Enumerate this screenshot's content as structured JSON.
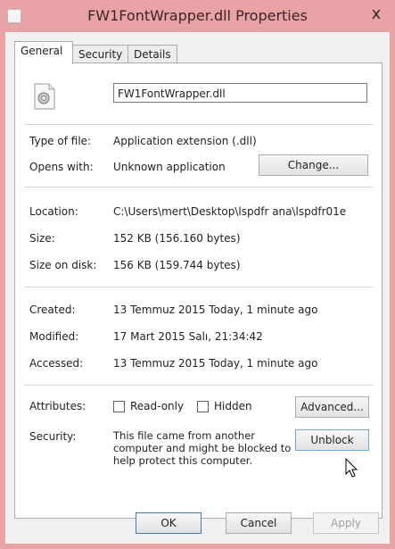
{
  "window": {
    "title": "FW1FontWrapper.dll Properties",
    "close_glyph": "x"
  },
  "tabs": [
    {
      "label": "General"
    },
    {
      "label": "Security"
    },
    {
      "label": "Details"
    }
  ],
  "file": {
    "name": "FW1FontWrapper.dll"
  },
  "fields": {
    "type_label": "Type of file:",
    "type_value": "Application extension (.dll)",
    "opens_label": "Opens with:",
    "opens_value": "Unknown application",
    "change_button": "Change...",
    "location_label": "Location:",
    "location_value": "C:\\Users\\mert\\Desktop\\lspdfr ana\\lspdfr01e",
    "size_label": "Size:",
    "size_value": "152 KB (156.160 bytes)",
    "size_disk_label": "Size on disk:",
    "size_disk_value": "156 KB (159.744 bytes)",
    "created_label": "Created:",
    "created_value": "13 Temmuz 2015 Today, 1 minute ago",
    "modified_label": "Modified:",
    "modified_value": "17 Mart 2015 Salı, 21:34:42",
    "accessed_label": "Accessed:",
    "accessed_value": "13 Temmuz 2015 Today, 1 minute ago",
    "attributes_label": "Attributes:",
    "readonly_label": "Read-only",
    "hidden_label": "Hidden",
    "advanced_button": "Advanced...",
    "security_label": "Security:",
    "security_text_1": "This file came from another",
    "security_text_2": "computer and might be blocked to",
    "security_text_3": "help protect this computer.",
    "unblock_button": "Unblock"
  },
  "footer": {
    "ok": "OK",
    "cancel": "Cancel",
    "apply": "Apply"
  },
  "colors": {
    "titlebar": "#e9a3a6",
    "dialog_bg": "#f0f0f0",
    "panel_bg": "#ffffff"
  },
  "icons": {
    "file": "dll-file-icon",
    "cursor": "mouse-pointer-icon"
  }
}
